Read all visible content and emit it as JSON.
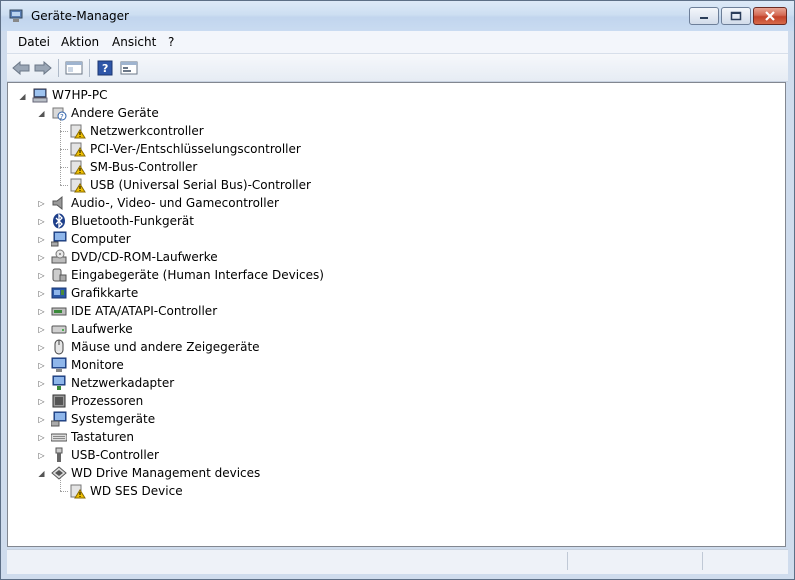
{
  "window": {
    "title": "Geräte-Manager"
  },
  "menu": [
    "Datei",
    "Aktion",
    "Ansicht",
    "?"
  ],
  "toolbar": {
    "back_icon": "back-arrow-icon",
    "forward_icon": "forward-arrow-icon",
    "view_icon": "console-tree-icon",
    "help_icon": "help-icon",
    "properties_icon": "properties-icon"
  },
  "tree": {
    "root": "W7HP-PC",
    "items": [
      {
        "label": "Andere Geräte",
        "icon": "unknown-device-icon",
        "expanded": true,
        "children": [
          "Netzwerkcontroller",
          "PCI-Ver-/Entschlüsselungscontroller",
          "SM-Bus-Controller",
          "USB (Universal Serial Bus)-Controller"
        ]
      },
      {
        "label": "Audio-, Video- und Gamecontroller",
        "icon": "speaker-icon"
      },
      {
        "label": "Bluetooth-Funkgerät",
        "icon": "bluetooth-icon"
      },
      {
        "label": "Computer",
        "icon": "computer-icon"
      },
      {
        "label": "DVD/CD-ROM-Laufwerke",
        "icon": "dvd-drive-icon"
      },
      {
        "label": "Eingabegeräte (Human Interface Devices)",
        "icon": "hid-icon"
      },
      {
        "label": "Grafikkarte",
        "icon": "display-adapter-icon"
      },
      {
        "label": "IDE ATA/ATAPI-Controller",
        "icon": "ide-controller-icon"
      },
      {
        "label": "Laufwerke",
        "icon": "disk-drive-icon"
      },
      {
        "label": "Mäuse und andere Zeigegeräte",
        "icon": "mouse-icon"
      },
      {
        "label": "Monitore",
        "icon": "monitor-icon"
      },
      {
        "label": "Netzwerkadapter",
        "icon": "network-adapter-icon"
      },
      {
        "label": "Prozessoren",
        "icon": "processor-icon"
      },
      {
        "label": "Systemgeräte",
        "icon": "system-devices-icon"
      },
      {
        "label": "Tastaturen",
        "icon": "keyboard-icon"
      },
      {
        "label": "USB-Controller",
        "icon": "usb-icon"
      },
      {
        "label": "WD Drive Management devices",
        "icon": "wd-device-icon",
        "expanded": true,
        "children": [
          "WD SES Device"
        ]
      }
    ]
  },
  "status": ""
}
